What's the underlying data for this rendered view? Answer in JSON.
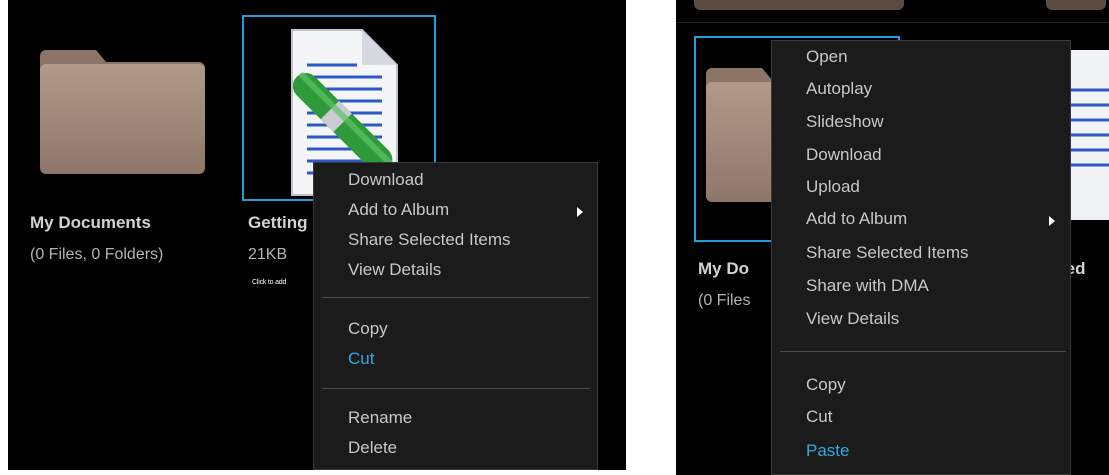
{
  "left": {
    "tiles": [
      {
        "title": "My Documents",
        "subtitle": "(0 Files, 0 Folders)",
        "icon": "folder-icon"
      },
      {
        "title": "Getting",
        "subtitle": "21KB",
        "hint": "Click to add",
        "icon": "document-icon"
      }
    ],
    "menu": {
      "group1": [
        "Download",
        "Add to Album",
        "Share Selected Items",
        "View Details"
      ],
      "group2": [
        "Copy",
        "Cut"
      ],
      "group3": [
        "Rename",
        "Delete"
      ],
      "active": "Cut"
    }
  },
  "right": {
    "tiles": [
      {
        "title": "My Do",
        "subtitle": "(0 Files",
        "icon": "folder-icon"
      },
      {
        "title": "ted",
        "icon": "document-icon"
      }
    ],
    "menu": {
      "group1": [
        "Open",
        "Autoplay",
        "Slideshow",
        "Download",
        "Upload",
        "Add to Album",
        "Share Selected Items",
        "Share with DMA",
        "View Details"
      ],
      "group2": [
        "Copy",
        "Cut",
        "Paste"
      ],
      "active": "Paste"
    }
  },
  "colors": {
    "panel_bg": "#000000",
    "menu_bg": "#1b1b1b",
    "menu_text": "#c8c8c8",
    "accent": "#2ea9e4",
    "selection": "#1f9fd6",
    "folder": "#a58c7c"
  }
}
